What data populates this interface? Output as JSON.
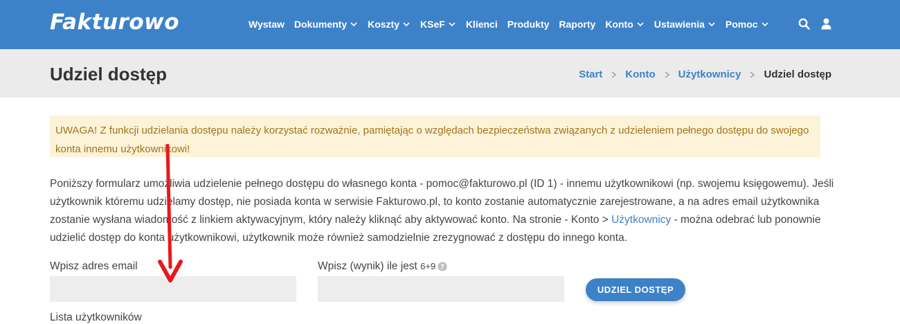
{
  "header": {
    "logo": "Fakturowo",
    "nav": [
      {
        "label": "Wystaw",
        "dropdown": false
      },
      {
        "label": "Dokumenty",
        "dropdown": true
      },
      {
        "label": "Koszty",
        "dropdown": true
      },
      {
        "label": "KSeF",
        "dropdown": true
      },
      {
        "label": "Klienci",
        "dropdown": false
      },
      {
        "label": "Produkty",
        "dropdown": false
      },
      {
        "label": "Raporty",
        "dropdown": false
      },
      {
        "label": "Konto",
        "dropdown": true
      },
      {
        "label": "Ustawienia",
        "dropdown": true
      },
      {
        "label": "Pomoc",
        "dropdown": true
      }
    ],
    "icons": [
      "search-icon",
      "user-icon"
    ]
  },
  "page": {
    "title": "Udziel dostęp",
    "breadcrumb": [
      "Start",
      "Konto",
      "Użytkownicy",
      "Udziel dostęp"
    ]
  },
  "warning": {
    "text": "UWAGA! Z funkcji udzielania dostępu należy korzystać rozważnie, pamiętając o względach bezpieczeństwa związanych z udzieleniem pełnego dostępu do swojego konta innemu użytkownikowi!"
  },
  "description": {
    "text_before_link": "Poniższy formularz umożliwia udzielenie pełnego dostępu do własnego konta - pomoc@fakturowo.pl (ID 1) - innemu użytkownikowi (np. swojemu księgowemu). Jeśli użytkownik któremu udzielamy dostęp, nie posiada konta w serwisie Fakturowo.pl, to konto zostanie automatycznie zarejestrowane, a na adres email użytkownika zostanie wysłana wiadomość z linkiem aktywacyjnym, który należy kliknąć aby aktywować konto. Na stronie - Konto > ",
    "link": "Użytkownicy",
    "text_after_link": " - można odebrać lub ponownie udzielić dostęp do konta użytkownikowi, użytkownik może również samodzielnie zrezygnować z dostępu do innego konta."
  },
  "form": {
    "email_label": "Wpisz adres email",
    "email_value": "",
    "captcha_label": "Wpisz (wynik) ile jest",
    "captcha_question": "6+9",
    "captcha_value": "",
    "submit_label": "UDZIEL DOSTĘP"
  },
  "below_form_text": "Lista użytkowników",
  "colors": {
    "brand": "#3d82c9",
    "warning_bg": "#fcf3d9",
    "warning_text": "#a4741a",
    "annotation_arrow": "#e8191a"
  }
}
